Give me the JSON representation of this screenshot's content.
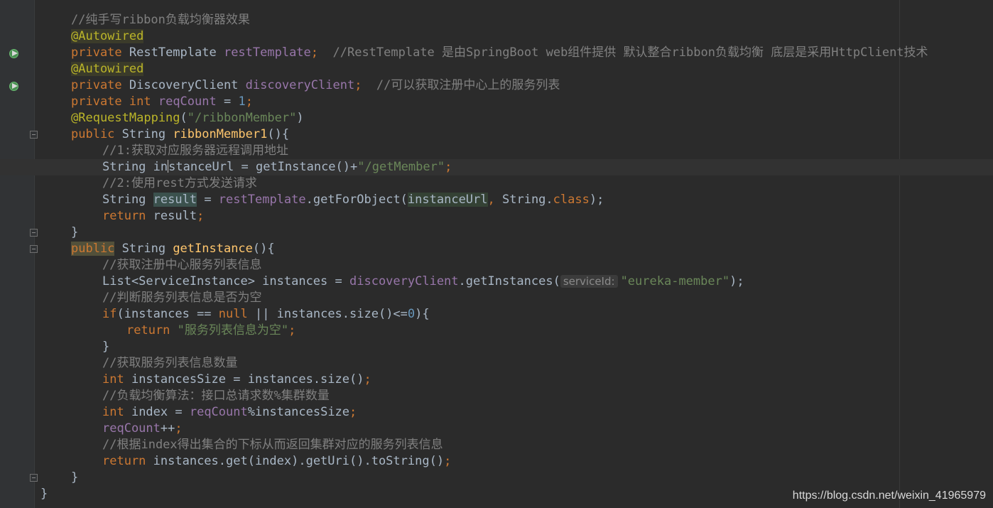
{
  "editor": {
    "code": {
      "l1": "//纯手写ribbon负载均衡器效果",
      "l2": "@Autowired",
      "l3_kw": "private",
      "l3_type": " RestTemplate ",
      "l3_field": "restTemplate",
      "l3_semi": ";",
      "l3_cmt": "  //RestTemplate 是由SpringBoot web组件提供 默认整合ribbon负载均衡 底层是采用HttpClient技术",
      "l4": "@Autowired",
      "l5_kw": "private",
      "l5_type": " DiscoveryClient ",
      "l5_field": "discoveryClient",
      "l5_semi": ";",
      "l5_cmt": "  //可以获取注册中心上的服务列表",
      "l6_kw1": "private",
      "l6_kw2": " int ",
      "l6_field": "reqCount",
      "l6_eq": " = ",
      "l6_num": "1",
      "l6_semi": ";",
      "l7_ann": "@RequestMapping",
      "l7_open": "(",
      "l7_str": "\"/ribbonMember\"",
      "l7_close": ")",
      "l8_kw": "public",
      "l8_type": " String ",
      "l8_mth": "ribbonMember1",
      "l8_rest": "(){",
      "l9": "//1:获取对应服务器远程调用地址",
      "l10_a": "String in",
      "l10_b": "stanceUrl",
      "l10_c": " = getInstance()+",
      "l10_str": "\"/getMember\"",
      "l10_semi": ";",
      "l11": "//2:使用rest方式发送请求",
      "l12_a": "String ",
      "l12_res": "result",
      "l12_b": " = ",
      "l12_fld": "restTemplate",
      "l12_c": ".getForObject(",
      "l12_var": "instanceUrl",
      "l12_comma": ", ",
      "l12_d": "String.",
      "l12_cls": "class",
      "l12_e": ");",
      "l13_kw": "return",
      "l13_rest": " result",
      "l13_semi": ";",
      "l14": "}",
      "l15_kw": "public",
      "l15_type": " String ",
      "l15_mth": "getInstance",
      "l15_rest": "(){",
      "l16": "//获取注册中心服务列表信息",
      "l17_a": "List<ServiceInstance> instances = ",
      "l17_fld": "discoveryClient",
      "l17_b": ".getInstances(",
      "l17_hint": "serviceId:",
      "l17_str": "\"eureka-member\"",
      "l17_c": ");",
      "l18": "//判断服务列表信息是否为空",
      "l19_kw": "if",
      "l19_a": "(instances == ",
      "l19_null": "null",
      "l19_b": " || instances.size()<=",
      "l19_num": "0",
      "l19_c": "){",
      "l20_kw": "return ",
      "l20_str": "\"服务列表信息为空\"",
      "l20_semi": ";",
      "l21": "}",
      "l22": "//获取服务列表信息数量",
      "l23_kw": "int",
      "l23_a": " instancesSize = instances.size()",
      "l23_semi": ";",
      "l24": "//负载均衡算法：接口总请求数%集群数量",
      "l25_kw": "int",
      "l25_a": " index = ",
      "l25_fld": "reqCount",
      "l25_b": "%instancesSize",
      "l25_semi": ";",
      "l26_fld": "reqCount",
      "l26_a": "++",
      "l26_semi": ";",
      "l27": "//根据index得出集合的下标从而返回集群对应的服务列表信息",
      "l28_kw": "return",
      "l28_a": " instances.get(index).getUri().toString()",
      "l28_semi": ";",
      "l29": "}",
      "l30": "}"
    },
    "watermark": "https://blog.csdn.net/weixin_41965979"
  }
}
